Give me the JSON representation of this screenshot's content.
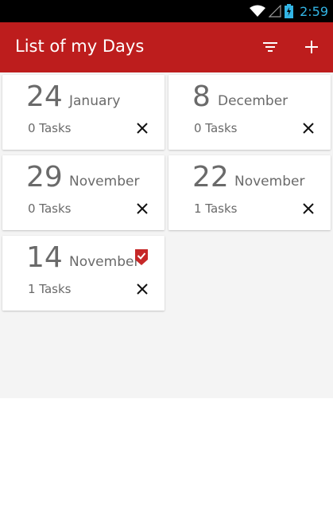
{
  "status_bar": {
    "time": "2:59",
    "icons": [
      "wifi-icon",
      "signal-icon",
      "battery-charging-icon"
    ]
  },
  "app_bar": {
    "title": "List of my Days",
    "actions": [
      "filter-icon",
      "add-icon"
    ]
  },
  "days": [
    {
      "day": "24",
      "month": "January",
      "tasks": "0 Tasks",
      "flagged": false
    },
    {
      "day": "8",
      "month": "December",
      "tasks": "0 Tasks",
      "flagged": false
    },
    {
      "day": "29",
      "month": "November",
      "tasks": "0 Tasks",
      "flagged": false
    },
    {
      "day": "22",
      "month": "November",
      "tasks": "1 Tasks",
      "flagged": false
    },
    {
      "day": "14",
      "month": "November",
      "tasks": "1 Tasks",
      "flagged": true
    }
  ],
  "colors": {
    "app_bar": "#bd1d1d",
    "status_text": "#33b5e5",
    "card_text": "#6a6a6a",
    "flag": "#c62828"
  }
}
